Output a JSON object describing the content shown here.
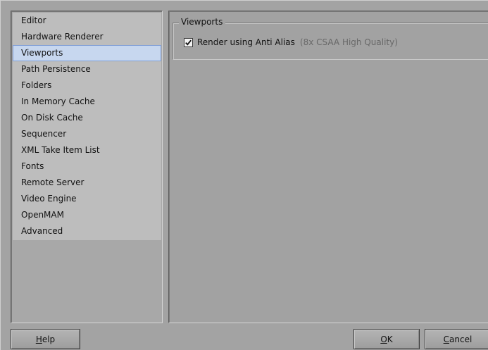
{
  "categories": [
    {
      "label": "Editor"
    },
    {
      "label": "Hardware Renderer"
    },
    {
      "label": "Viewports",
      "selected": true
    },
    {
      "label": "Path Persistence"
    },
    {
      "label": "Folders"
    },
    {
      "label": "In Memory Cache"
    },
    {
      "label": "On Disk Cache"
    },
    {
      "label": "Sequencer"
    },
    {
      "label": "XML Take Item List"
    },
    {
      "label": "Fonts"
    },
    {
      "label": "Remote Server"
    },
    {
      "label": "Video Engine"
    },
    {
      "label": "OpenMAM"
    },
    {
      "label": "Advanced"
    }
  ],
  "viewports": {
    "group_title": "Viewports",
    "anti_alias": {
      "checked": true,
      "label": "Render using Anti Alias",
      "detail": "(8x CSAA High Quality)",
      "checkmark_icon": "checkmark-icon"
    }
  },
  "buttons": {
    "help": {
      "accel": "H",
      "rest": "elp"
    },
    "ok": {
      "accel": "O",
      "rest": "K"
    },
    "cancel": {
      "accel": "C",
      "rest": "ancel"
    }
  },
  "colors": {
    "selection_bg": "#c7d7ef",
    "selection_border": "#7f9ed6",
    "list_bg": "#bdbdbd",
    "window_bg": "#a3a3a3"
  }
}
